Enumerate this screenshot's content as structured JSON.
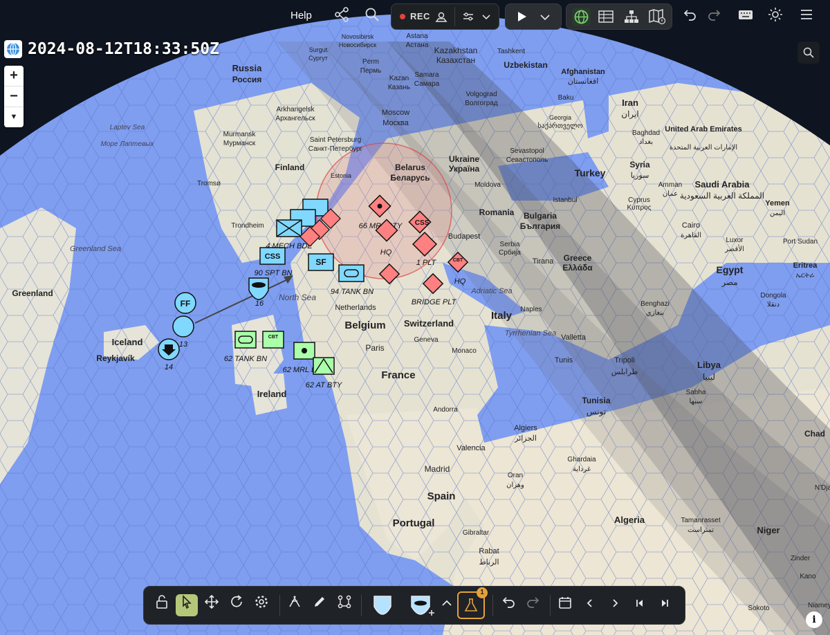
{
  "topbar": {
    "help_label": "Help",
    "rec_label": "REC",
    "icons": [
      "share-icon",
      "search-icon",
      "record-icon",
      "settings-sliders-icon",
      "chevron-down-icon",
      "play-icon",
      "globe-icon",
      "table-icon",
      "hierarchy-icon",
      "map-icon",
      "undo-icon",
      "redo-icon",
      "keyboard-icon",
      "brightness-icon",
      "menu-icon"
    ]
  },
  "timestamp": "2024-08-12T18:33:50Z",
  "map_labels": {
    "countries": [
      "Russia",
      "Россия",
      "Finland",
      "Belarus",
      "Беларусь",
      "Ukraine",
      "Україна",
      "Turkey",
      "Iran",
      "ایران",
      "Syria",
      "سوريا",
      "Saudi Arabia",
      "المملكة العربية السعودية",
      "Egypt",
      "مصر",
      "Libya",
      "ليبيا",
      "Tunisia",
      "تونس",
      "Algeria",
      "Niger",
      "Chad",
      "Belgium",
      "France",
      "Switzerland",
      "Italy",
      "Spain",
      "Portugal",
      "Ireland",
      "Iceland",
      "Greenland",
      "Netherlands",
      "Kazakhstan",
      "Казахстан",
      "Uzbekistan",
      "Afghanistan",
      "افغانستان",
      "Romania",
      "Bulgaria",
      "България",
      "Serbia",
      "Србија",
      "Greece",
      "Ελλάδα",
      "Cyprus",
      "Κύπρος",
      "United Arab Emirates",
      "الإمارات العربية المتحدة",
      "Yemen",
      "اليمن",
      "Moldova",
      "Georgia",
      "საქართველო",
      "Eritrea",
      "ኤርትራ",
      "Monaco",
      "Andorra"
    ],
    "cities": [
      "Moscow",
      "Москва",
      "Saint Petersburg",
      "Санкт-Петербург",
      "Arkhangelsk",
      "Архангельск",
      "Murmansk",
      "Мурманск",
      "Tromsø",
      "Trondheim",
      "Reykjavík",
      "Estonia",
      "Kazan",
      "Казань",
      "Samara",
      "Самара",
      "Perm",
      "Пермь",
      "Tashkent",
      "Astana",
      "Астана",
      "Novosibirsk",
      "Новосибирск",
      "Surgut",
      "Сургут",
      "Volgograd",
      "Волгоград",
      "Sevastopol",
      "Севастополь",
      "Baku",
      "Baghdad",
      "بغداد",
      "Amman",
      "عمان",
      "Cairo",
      "القاهرة",
      "Istanbul",
      "Budapest",
      "Tirana",
      "Naples",
      "Valletta",
      "Tunis",
      "Tripoli",
      "طرابلس",
      "Benghazi",
      "بنغازي",
      "Algiers",
      "الجزائر",
      "Ghardaia",
      "غرداية",
      "Oran",
      "وهران",
      "Tamanrasset",
      "تمنراست",
      "Madrid",
      "Valencia",
      "Gibraltar",
      "Rabat",
      "الرباط",
      "Geneva",
      "Paris",
      "Sabha",
      "سبها",
      "Luxor",
      "الأقصر",
      "Dongola",
      "دنقلا",
      "Port Sudan",
      "Zinder",
      "Kano",
      "Sokoto",
      "N'Dja",
      "Niamey"
    ],
    "seas": [
      "North Sea",
      "Greenland Sea",
      "Adriatic Sea",
      "Tyrrhenian Sea",
      "Laptev Sea",
      "Море Лаптевых"
    ]
  },
  "units": {
    "friendly": [
      {
        "type": "FF",
        "label": ""
      },
      {
        "type": "support",
        "label": "13"
      },
      {
        "type": "arrow",
        "label": "14"
      },
      {
        "type": "special",
        "label": "16"
      },
      {
        "type": "CSS",
        "label": "90 SPT BN"
      },
      {
        "type": "SF",
        "label": ""
      },
      {
        "type": "armor",
        "label": "94 TANK BN"
      },
      {
        "type": "infantry",
        "label": "4 MECH BDE"
      }
    ],
    "neutral": [
      {
        "type": "armor",
        "label": "62 TANK BN"
      },
      {
        "type": "CBT",
        "label": ""
      },
      {
        "type": "MRL",
        "label": "62 MRL BTY"
      },
      {
        "type": "AT",
        "label": "62 AT BTY"
      }
    ],
    "hostile": [
      {
        "type": "MRL",
        "label": "66 MRL BTY"
      },
      {
        "type": "CSS",
        "label": ""
      },
      {
        "type": "HQ",
        "label": "HQ"
      },
      {
        "type": "PLT",
        "label": "1 PLT"
      },
      {
        "type": "CBT",
        "label": "HQ"
      },
      {
        "type": "BRIDGE",
        "label": "BRIDGE PLT"
      }
    ],
    "hostile_codes": {
      "css": "CSS",
      "cbt": "CBT"
    },
    "friendly_codes": {
      "ff": "FF",
      "css": "CSS",
      "sf": "SF"
    }
  },
  "bottombar": {
    "tools": [
      "lock-icon",
      "select-icon",
      "move-icon",
      "rotate-icon",
      "settings-icon",
      "symbol-tool-icon",
      "pencil-icon",
      "path-icon",
      "friendly-shield-icon",
      "unit-add-icon",
      "chevron-up-icon",
      "lab-icon",
      "undo-icon",
      "redo-icon",
      "calendar-icon",
      "prev-icon",
      "next-icon",
      "first-icon",
      "last-icon"
    ],
    "lab_badge": "1"
  },
  "colors": {
    "friendly": "#80d8ff",
    "neutral": "#aaffaa",
    "hostile": "#ff8080",
    "ocean": "#7fa0f0",
    "land": "#e8e4d6",
    "night": "#5a5f6a"
  }
}
